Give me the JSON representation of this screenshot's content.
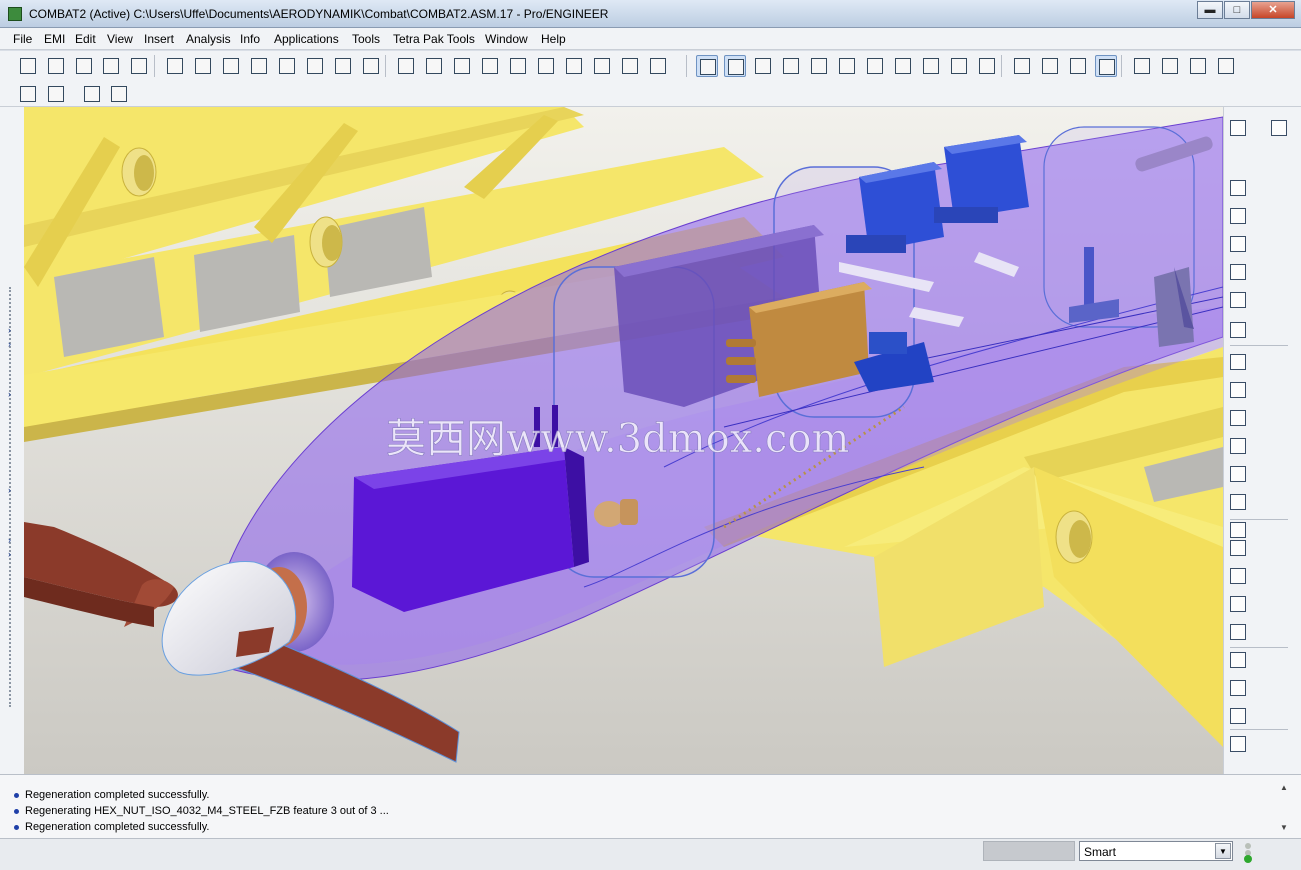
{
  "window": {
    "title": "COMBAT2 (Active) C:\\Users\\Uffe\\Documents\\AERODYNAMIK\\Combat\\COMBAT2.ASM.17 - Pro/ENGINEER",
    "minimize_glyph": "▬",
    "maximize_glyph": "□",
    "close_glyph": "✕"
  },
  "menu": [
    "File",
    "EMI",
    "Edit",
    "View",
    "Insert",
    "Analysis",
    "Info",
    "Applications",
    "Tools",
    "Tetra Pak Tools",
    "Window",
    "Help"
  ],
  "toolbar": {
    "row1_icons": [
      "new-icon",
      "window-icon",
      "close-window-icon",
      "regenerate-icon",
      "edit-icon",
      "layer-icon",
      "blank-page-icon",
      "open-folder-icon",
      "arrow-right-icon",
      "save-icon",
      "print-preview-icon",
      "export-pdf-icon",
      "print-icon",
      "undo-icon",
      "redo-icon",
      "cut-icon",
      "copy-icon",
      "paste-icon",
      "paste-special-icon",
      "regenerate-tree-icon",
      "regenerate-manager-icon",
      "find-icon",
      "selection-box-icon",
      "repaint-icon",
      "spin-center-icon",
      "orient-icon",
      "pan-icon",
      "zoom-in-icon",
      "zoom-out-icon",
      "refit-icon",
      "view-manager-icon",
      "saved-views-icon",
      "layers-icon",
      "model-display-icon",
      "wireframe-icon",
      "hidden-line-icon",
      "no-hidden-icon",
      "shading-icon",
      "datum-planes-icon",
      "datum-axes-icon",
      "datum-points-icon",
      "coordinate-systems-icon"
    ],
    "row2_icons": [
      "help-icon",
      "whats-this-icon",
      "model-check-icon",
      "model-player-icon"
    ],
    "active_icons": [
      "repaint-icon",
      "spin-center-icon",
      "shading-icon"
    ]
  },
  "right_toolbar_icons": [
    "dimension-icon",
    "mirror-icon",
    "curve-icon",
    "plane-icon",
    "axis-icon",
    "spline-icon",
    "point-icon",
    "csys-icon",
    "analysis-icon",
    "copy-icon",
    "round-icon",
    "pattern-icon",
    "shell-icon",
    "sweep-icon",
    "rib-icon",
    "draft-icon",
    "extrude-icon",
    "revolve-icon",
    "blend-icon",
    "boundary-icon",
    "annotation-icon",
    "relations-icon",
    "groups-icon"
  ],
  "watermark": "莫西网www.3dmox.com",
  "messages": [
    "Regeneration completed successfully.",
    "Regenerating HEX_NUT_ISO_4032_M4_STEEL_FZB feature 3 out of 3 ...",
    "Regeneration completed successfully."
  ],
  "status": {
    "filter_value": "Smart",
    "filter_arrow": "▼",
    "scroll_up": "▲",
    "scroll_down": "▼"
  },
  "colors": {
    "wing": "#f5e66a",
    "wing_shadow": "#d9c14a",
    "fuselage": "#8a5cf0",
    "battery": "#5b17d6",
    "servo": "#2e4fd6",
    "propeller": "#8b3a2a",
    "spinner": "#ffffff"
  }
}
